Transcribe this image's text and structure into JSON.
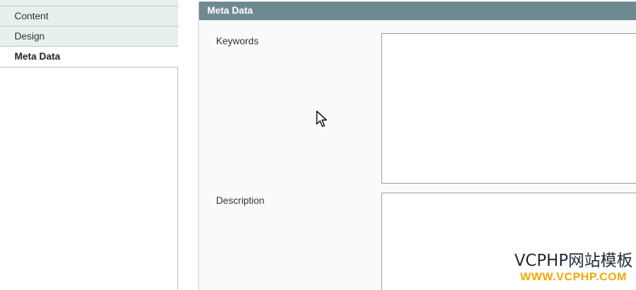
{
  "sidebar": {
    "tabs": [
      {
        "label": "",
        "state": "partial"
      },
      {
        "label": "Content",
        "state": "inactive"
      },
      {
        "label": "Design",
        "state": "inactive"
      },
      {
        "label": "Meta Data",
        "state": "active"
      }
    ]
  },
  "fieldset": {
    "title": "Meta Data",
    "fields": {
      "keywords": {
        "label": "Keywords",
        "value": ""
      },
      "description": {
        "label": "Description",
        "value": ""
      }
    }
  },
  "watermark": {
    "line1": "VCPHP网站模板",
    "line2": "WWW.VCPHP.COM"
  },
  "colors": {
    "header_bg": "#6f8992",
    "tab_bg": "#e7efef",
    "panel_bg": "#fafafa",
    "watermark_accent": "#f0a800"
  },
  "icons": [
    "mouse-cursor-icon"
  ]
}
